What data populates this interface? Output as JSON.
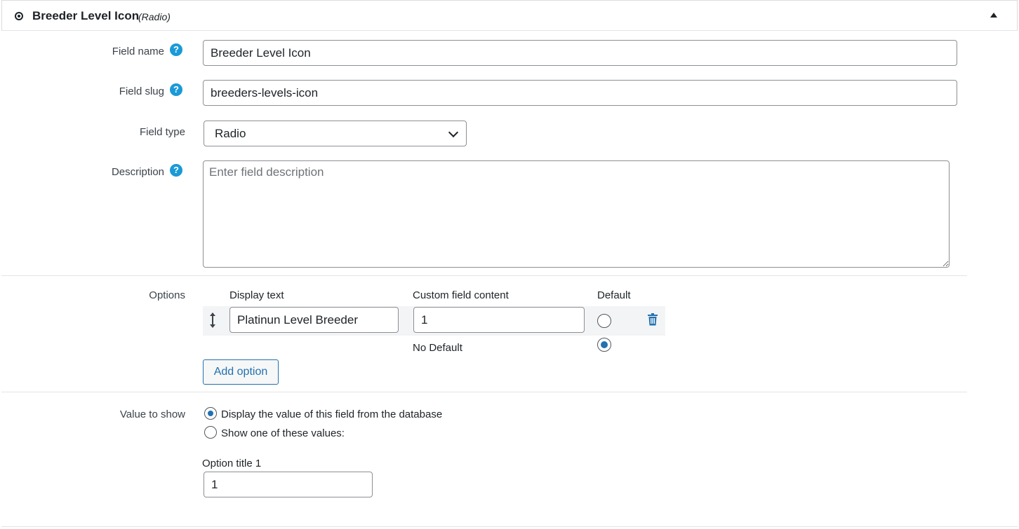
{
  "header": {
    "title": "Breeder Level Icon",
    "type_label": "(Radio)"
  },
  "fields": {
    "field_name": {
      "label": "Field name",
      "value": "Breeder Level Icon",
      "help": "?"
    },
    "field_slug": {
      "label": "Field slug",
      "value": "breeders-levels-icon",
      "help": "?"
    },
    "field_type": {
      "label": "Field type",
      "value": "Radio"
    },
    "description": {
      "label": "Description",
      "placeholder": "Enter field description",
      "help": "?"
    }
  },
  "options": {
    "label": "Options",
    "columns": {
      "display_text": "Display text",
      "custom_content": "Custom field content",
      "default": "Default"
    },
    "rows": [
      {
        "display_text": "Platinun Level Breeder",
        "custom_content": "1",
        "is_default": false
      }
    ],
    "no_default_label": "No Default",
    "no_default_selected": true,
    "add_button": "Add option"
  },
  "value_to_show": {
    "label": "Value to show",
    "choices": [
      {
        "label": "Display the value of this field from the database",
        "selected": true
      },
      {
        "label": "Show one of these values:",
        "selected": false
      }
    ],
    "option_title_label": "Option title 1",
    "option_title_value": "1"
  },
  "colors": {
    "accent": "#2271b1",
    "help_icon": "#1a9ad6",
    "border": "#8c8f94"
  }
}
